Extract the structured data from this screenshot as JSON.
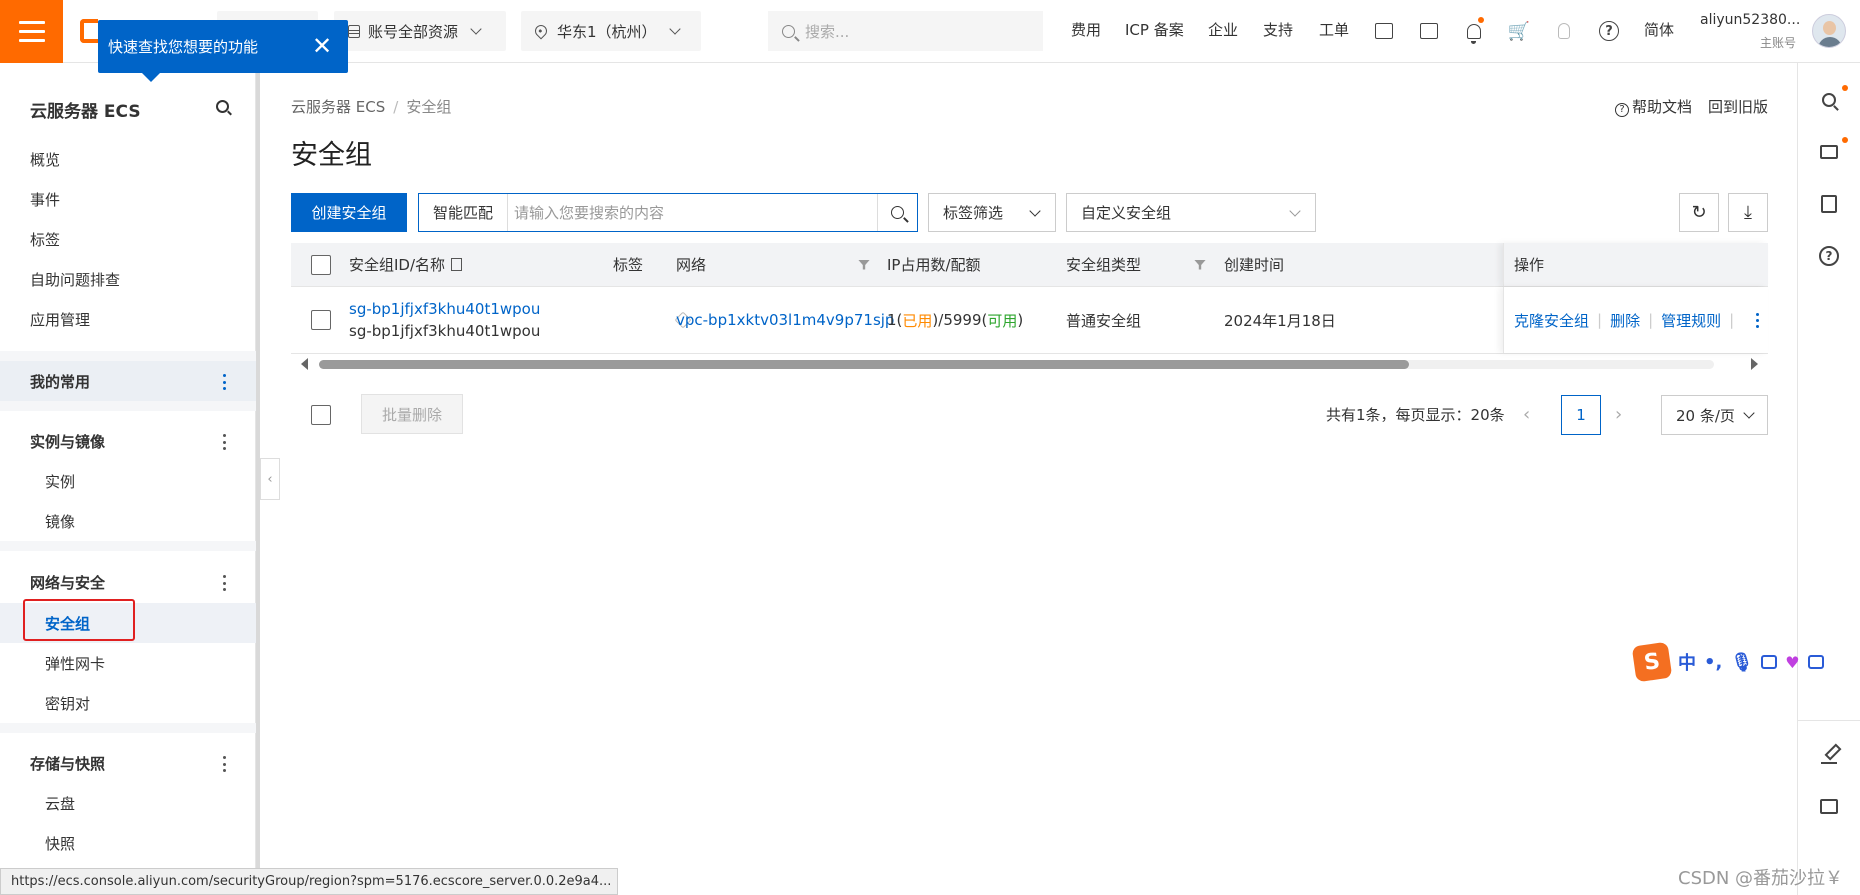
{
  "header": {
    "resource_label": "账号全部资源",
    "region_label": "华东1（杭州）",
    "search_placeholder": "搜索...",
    "links": [
      "费用",
      "ICP 备案",
      "企业",
      "支持",
      "工单"
    ],
    "lang": "简体",
    "user_name": "aliyun52380...",
    "user_role": "主账号"
  },
  "tooltip": {
    "text": "快速查找您想要的功能",
    "close": "✕"
  },
  "sidebar": {
    "title": "云服务器 ECS",
    "top_items": [
      "概览",
      "事件",
      "标签",
      "自助问题排查",
      "应用管理"
    ],
    "favorites": "我的常用",
    "groups": [
      {
        "title": "实例与镜像",
        "items": [
          "实例",
          "镜像"
        ]
      },
      {
        "title": "网络与安全",
        "items": [
          "安全组",
          "弹性网卡",
          "密钥对"
        ]
      },
      {
        "title": "存储与快照",
        "items": [
          "云盘",
          "快照"
        ]
      }
    ]
  },
  "main": {
    "breadcrumb": [
      "云服务器 ECS",
      "安全组"
    ],
    "help_doc": "帮助文档",
    "back_old": "回到旧版",
    "page_title": "安全组",
    "create_button": "创建安全组",
    "search_prefix": "智能匹配",
    "search_placeholder": "请输入您要搜索的内容",
    "tag_filter": "标签筛选",
    "custom_group": "自定义安全组"
  },
  "table": {
    "columns": [
      "安全组ID/名称",
      "标签",
      "网络",
      "IP占用数/配额",
      "安全组类型",
      "创建时间",
      "操作"
    ],
    "rows": [
      {
        "id": "sg-bp1jfjxf3khu40t1wpou",
        "name": "sg-bp1jfjxf3khu40t1wpou",
        "network": "vpc-bp1xktv03l1m4v9p71sjp",
        "ip_used": "1",
        "ip_used_label": "已用",
        "ip_quota": "5999",
        "ip_avail_label": "可用",
        "type": "普通安全组",
        "created": "2024年1月18日",
        "actions": [
          "克隆安全组",
          "删除",
          "管理规则"
        ]
      }
    ]
  },
  "footer": {
    "batch_delete": "批量删除",
    "total": "共有1条，每页显示：20条",
    "page": "1",
    "page_size": "20 条/页"
  },
  "ime": {
    "lang": "中"
  },
  "status_url": "https://ecs.console.aliyun.com/securityGroup/region?spm=5176.ecscore_server.0.0.2e9a4...",
  "watermark": "CSDN @番茄沙拉￥",
  "colors": {
    "brand": "#ff6a00",
    "primary": "#0064c8",
    "used": "#ff8a00",
    "available": "#2da52d",
    "highlight": "#e02020"
  }
}
